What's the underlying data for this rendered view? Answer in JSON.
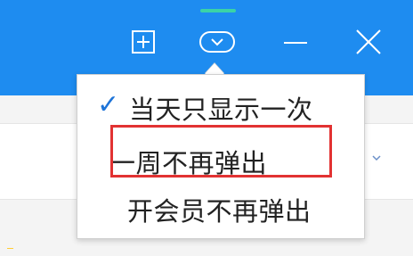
{
  "titlebar": {
    "icons": {
      "add": "add-window-icon",
      "skin": "skin-icon",
      "minimize": "minimize-icon",
      "close": "close-icon"
    }
  },
  "menu": {
    "items": [
      {
        "label": "当天只显示一次",
        "checked": true
      },
      {
        "label": "一周不再弹出",
        "checked": false
      },
      {
        "label": "开会员不再弹出",
        "checked": false
      }
    ],
    "check_mark": "✓"
  },
  "colors": {
    "titlebar_blue": "#1e8cf0",
    "indicator_green": "#3bd3a7",
    "check_blue": "#1e74d8",
    "highlight_red": "#e23232"
  }
}
